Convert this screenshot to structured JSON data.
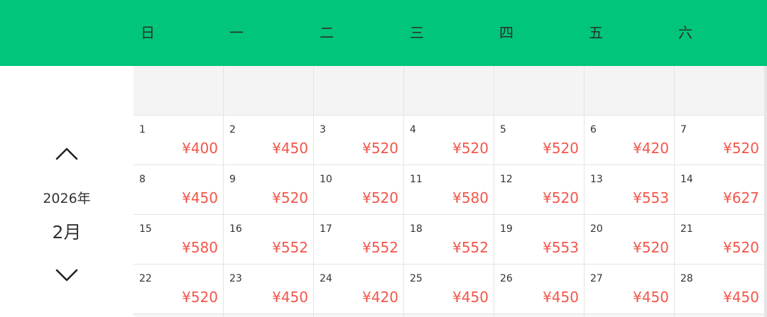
{
  "header": {
    "weekdays": [
      "日",
      "一",
      "二",
      "三",
      "四",
      "五",
      "六"
    ]
  },
  "nav": {
    "prev_icon": "chevron-up-icon",
    "next_icon": "chevron-down-icon",
    "year": "2026年",
    "month": "2月"
  },
  "calendar": {
    "weeks": [
      [
        {
          "day": "1",
          "price": "¥400"
        },
        {
          "day": "2",
          "price": "¥450"
        },
        {
          "day": "3",
          "price": "¥520"
        },
        {
          "day": "4",
          "price": "¥520"
        },
        {
          "day": "5",
          "price": "¥520"
        },
        {
          "day": "6",
          "price": "¥420"
        },
        {
          "day": "7",
          "price": "¥520"
        }
      ],
      [
        {
          "day": "8",
          "price": "¥450"
        },
        {
          "day": "9",
          "price": "¥520"
        },
        {
          "day": "10",
          "price": "¥520"
        },
        {
          "day": "11",
          "price": "¥580"
        },
        {
          "day": "12",
          "price": "¥520"
        },
        {
          "day": "13",
          "price": "¥553"
        },
        {
          "day": "14",
          "price": "¥627"
        }
      ],
      [
        {
          "day": "15",
          "price": "¥580"
        },
        {
          "day": "16",
          "price": "¥552"
        },
        {
          "day": "17",
          "price": "¥552"
        },
        {
          "day": "18",
          "price": "¥552"
        },
        {
          "day": "19",
          "price": "¥553"
        },
        {
          "day": "20",
          "price": "¥520"
        },
        {
          "day": "21",
          "price": "¥520"
        }
      ],
      [
        {
          "day": "22",
          "price": "¥520"
        },
        {
          "day": "23",
          "price": "¥450"
        },
        {
          "day": "24",
          "price": "¥420"
        },
        {
          "day": "25",
          "price": "¥450"
        },
        {
          "day": "26",
          "price": "¥450"
        },
        {
          "day": "27",
          "price": "¥450"
        },
        {
          "day": "28",
          "price": "¥450"
        }
      ]
    ]
  },
  "colors": {
    "header_bg": "#00c57a",
    "price": "#f2564a"
  }
}
